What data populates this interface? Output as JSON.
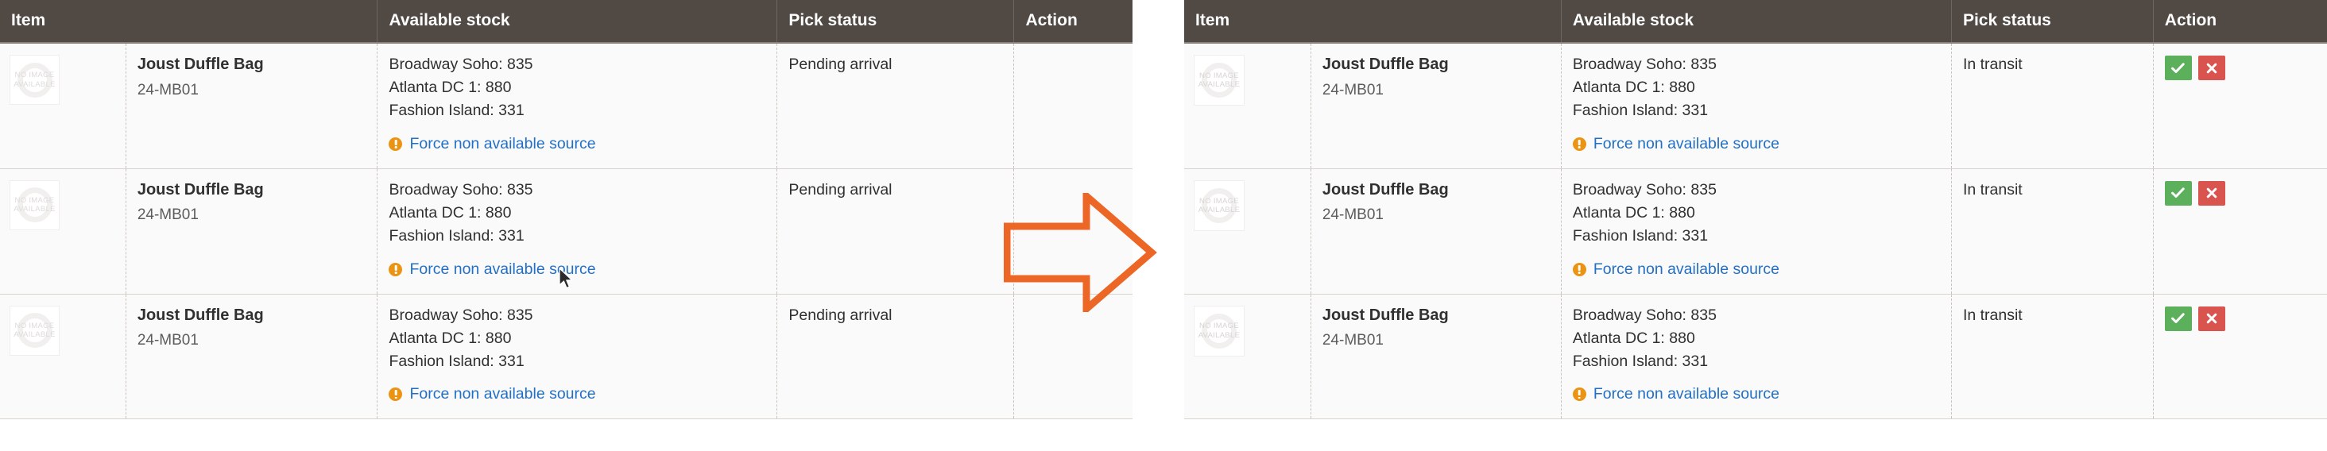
{
  "columns": {
    "item": "Item",
    "available_stock": "Available stock",
    "pick_status": "Pick status",
    "action": "Action"
  },
  "thumbnail": {
    "line1": "NO IMAGE",
    "line2": "AVAILABLE"
  },
  "product": {
    "name": "Joust Duffle Bag",
    "sku": "24-MB01"
  },
  "stock": {
    "line1": "Broadway Soho: 835",
    "line2": "Atlanta DC 1: 880",
    "line3": "Fashion Island: 331"
  },
  "force_link": {
    "label": "Force non available source",
    "icon": "warning-circle-icon"
  },
  "status": {
    "before": "Pending arrival",
    "after": "In transit"
  },
  "action_buttons": {
    "accept": "check-icon",
    "reject": "cross-icon"
  },
  "annotation": {
    "arrow": "right-arrow-icon",
    "arrow_color": "#ec6726"
  },
  "colors": {
    "header_bg": "#514943",
    "row_bg": "#fbfafa",
    "link": "#2270c6",
    "warning": "#eb9413",
    "accept": "#5cb05c",
    "reject": "#d9534f",
    "arrow": "#ec6726"
  },
  "left_table": {
    "rows": [
      {
        "thumb_l1": "NO IMAGE",
        "thumb_l2": "AVAILABLE",
        "name": "Joust Duffle Bag",
        "sku": "24-MB01",
        "s1": "Broadway Soho: 835",
        "s2": "Atlanta DC 1: 880",
        "s3": "Fashion Island: 331",
        "force": "Force non available source",
        "status": "Pending arrival"
      },
      {
        "thumb_l1": "NO IMAGE",
        "thumb_l2": "AVAILABLE",
        "name": "Joust Duffle Bag",
        "sku": "24-MB01",
        "s1": "Broadway Soho: 835",
        "s2": "Atlanta DC 1: 880",
        "s3": "Fashion Island: 331",
        "force": "Force non available source",
        "status": "Pending arrival"
      },
      {
        "thumb_l1": "NO IMAGE",
        "thumb_l2": "AVAILABLE",
        "name": "Joust Duffle Bag",
        "sku": "24-MB01",
        "s1": "Broadway Soho: 835",
        "s2": "Atlanta DC 1: 880",
        "s3": "Fashion Island: 331",
        "force": "Force non available source",
        "status": "Pending arrival"
      }
    ]
  },
  "right_table": {
    "rows": [
      {
        "thumb_l1": "NO IMAGE",
        "thumb_l2": "AVAILABLE",
        "name": "Joust Duffle Bag",
        "sku": "24-MB01",
        "s1": "Broadway Soho: 835",
        "s2": "Atlanta DC 1: 880",
        "s3": "Fashion Island: 331",
        "force": "Force non available source",
        "status": "In transit"
      },
      {
        "thumb_l1": "NO IMAGE",
        "thumb_l2": "AVAILABLE",
        "name": "Joust Duffle Bag",
        "sku": "24-MB01",
        "s1": "Broadway Soho: 835",
        "s2": "Atlanta DC 1: 880",
        "s3": "Fashion Island: 331",
        "force": "Force non available source",
        "status": "In transit"
      },
      {
        "thumb_l1": "NO IMAGE",
        "thumb_l2": "AVAILABLE",
        "name": "Joust Duffle Bag",
        "sku": "24-MB01",
        "s1": "Broadway Soho: 835",
        "s2": "Atlanta DC 1: 880",
        "s3": "Fashion Island: 331",
        "force": "Force non available source",
        "status": "In transit"
      }
    ]
  }
}
